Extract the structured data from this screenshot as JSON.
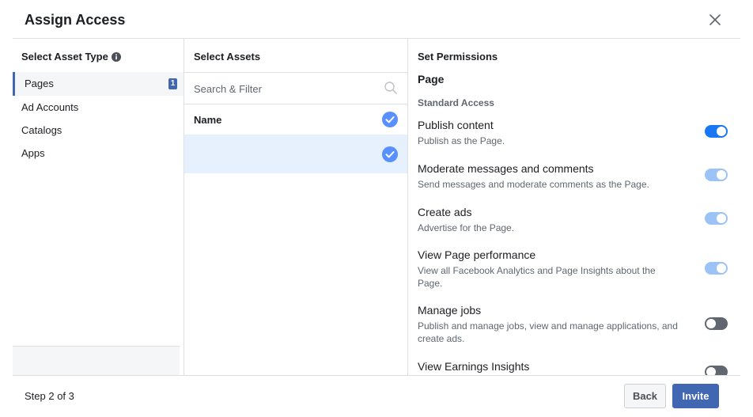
{
  "dialog": {
    "title": "Assign Access"
  },
  "columns": {
    "asset_type": {
      "header": "Select Asset Type",
      "items": [
        {
          "label": "Pages",
          "count": "1",
          "selected": true
        },
        {
          "label": "Ad Accounts"
        },
        {
          "label": "Catalogs"
        },
        {
          "label": "Apps"
        }
      ]
    },
    "assets": {
      "header": "Select Assets",
      "search_placeholder": "Search & Filter",
      "name_header": "Name",
      "rows": [
        {
          "name": "",
          "checked": true
        }
      ]
    },
    "permissions": {
      "header": "Set Permissions",
      "section": "Page",
      "subsection": "Standard Access",
      "items": [
        {
          "title": "Publish content",
          "desc": "Publish as the Page.",
          "state": "on"
        },
        {
          "title": "Moderate messages and comments",
          "desc": "Send messages and moderate comments as the Page.",
          "state": "on-disabled"
        },
        {
          "title": "Create ads",
          "desc": "Advertise for the Page.",
          "state": "on-disabled"
        },
        {
          "title": "View Page performance",
          "desc": "View all Facebook Analytics and Page Insights about the Page.",
          "state": "on-disabled"
        },
        {
          "title": "Manage jobs",
          "desc": "Publish and manage jobs, view and manage applications, and create ads.",
          "state": "off"
        },
        {
          "title": "View Earnings Insights",
          "desc": "",
          "state": "off"
        }
      ]
    }
  },
  "footer": {
    "step": "Step 2 of 3",
    "back_label": "Back",
    "invite_label": "Invite"
  },
  "colors": {
    "accent": "#4267b2",
    "toggle_on": "#1877f2",
    "toggle_on_disabled": "#9bc3f5",
    "toggle_off": "#606770",
    "check": "#5890ff",
    "selected_row": "#e7f0fd"
  }
}
